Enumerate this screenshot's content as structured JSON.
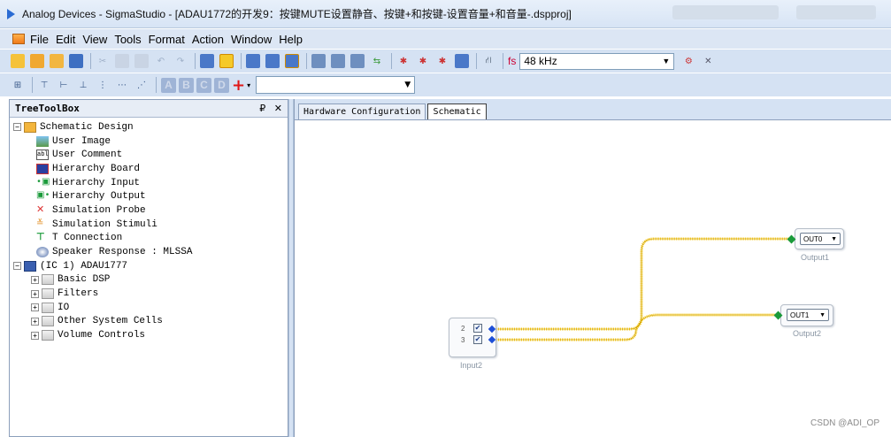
{
  "window": {
    "title": "Analog Devices - SigmaStudio - [ADAU1772的开发9：按键MUTE设置静音、按键+和按键-设置音量+和音量-.dspproj]"
  },
  "menu": [
    "File",
    "Edit",
    "View",
    "Tools",
    "Format",
    "Action",
    "Window",
    "Help"
  ],
  "toolbar": {
    "sample_rate_label": "fs",
    "sample_rate": "48 kHz",
    "letter_buttons": [
      "A",
      "B",
      "C",
      "D"
    ],
    "add_label": "+"
  },
  "toolbox": {
    "title": "TreeToolBox",
    "pin_glyph": "₽",
    "close_glyph": "✕",
    "schematic_design": "Schematic Design",
    "items": [
      "User Image",
      "User Comment",
      "Hierarchy Board",
      "Hierarchy Input",
      "Hierarchy Output",
      "Simulation Probe",
      "Simulation Stimuli",
      "T Connection",
      "Speaker Response : MLSSA"
    ],
    "ic": "(IC 1) ADAU1777",
    "folders": [
      "Basic DSP",
      "Filters",
      "IO",
      "Other System Cells",
      "Volume Controls"
    ]
  },
  "tabs": [
    "Hardware Configuration",
    "Schematic"
  ],
  "schematic": {
    "input_block": {
      "caption": "Input2",
      "channels": [
        "2",
        "3"
      ]
    },
    "outputs": [
      {
        "label": "OUT0",
        "caption": "Output1"
      },
      {
        "label": "OUT1",
        "caption": "Output2"
      }
    ],
    "wire_color": "#f2c200"
  },
  "watermark": "CSDN @ADI_OP"
}
